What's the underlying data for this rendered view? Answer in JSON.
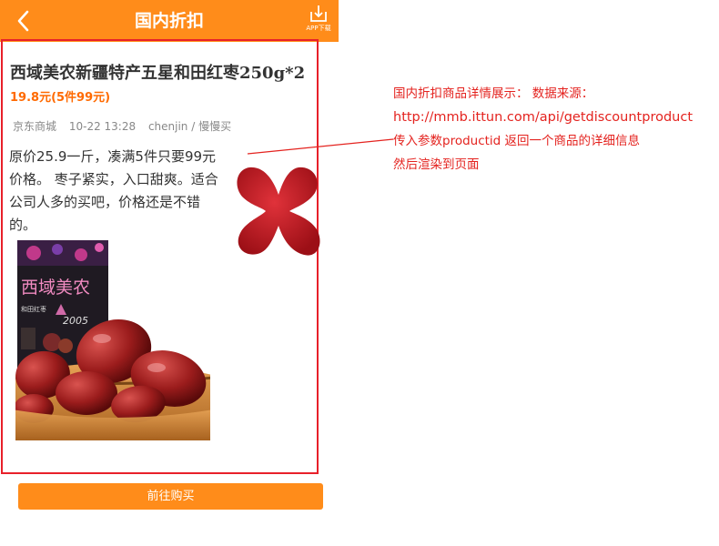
{
  "header": {
    "title": "国内折扣",
    "app_download_label": "APP下载"
  },
  "product": {
    "title": "西域美农新疆特产五星和田红枣250g*2",
    "price": "19.8元(5件99元)",
    "meta": {
      "shop": "京东商城",
      "time": "10-22 13:28",
      "author": "chenjin / 慢慢买"
    },
    "description": "原价25.9一斤，凑满5件只要99元价格。 枣子紧实，入口甜爽。适合公司人多的买吧，价格还是不错的。",
    "package_brand": "西域美农",
    "package_subtitle": "和田红枣",
    "package_year": "2005"
  },
  "buy_button_label": "前往购买",
  "annotation": {
    "line1": "国内折扣商品详情展示： 数据来源：",
    "line2": "http://mmb.ittun.com/api/getdiscountproduct",
    "line3": "传入参数productid 返回一个商品的详细信息",
    "line4": "然后渲染到页面"
  },
  "colors": {
    "header": "#ff8c1a",
    "annotation": "#e4231f",
    "price": "#ff6a00",
    "frame": "#e8202a",
    "x_mark": "#c8161e"
  }
}
